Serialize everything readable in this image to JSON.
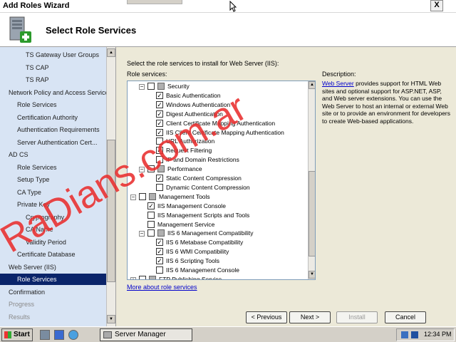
{
  "window": {
    "title": "Add Roles Wizard",
    "close_label": "X"
  },
  "header": {
    "heading": "Select Role Services"
  },
  "sidebar": {
    "items": [
      {
        "label": "TS Gateway User Groups",
        "state": "normal"
      },
      {
        "label": "TS CAP",
        "state": "normal"
      },
      {
        "label": "TS RAP",
        "state": "normal"
      },
      {
        "label": "Network Policy and Access Services",
        "state": "normal"
      },
      {
        "label": "Role Services",
        "state": "normal"
      },
      {
        "label": "Certification Authority",
        "state": "normal"
      },
      {
        "label": "Authentication Requirements",
        "state": "normal"
      },
      {
        "label": "Server Authentication Cert...",
        "state": "normal"
      },
      {
        "label": "AD CS",
        "state": "normal"
      },
      {
        "label": "Role Services",
        "state": "normal"
      },
      {
        "label": "Setup Type",
        "state": "normal"
      },
      {
        "label": "CA Type",
        "state": "normal"
      },
      {
        "label": "Private Key",
        "state": "normal"
      },
      {
        "label": "Cryptography",
        "state": "normal"
      },
      {
        "label": "CA Name",
        "state": "normal"
      },
      {
        "label": "Validity Period",
        "state": "normal"
      },
      {
        "label": "Certificate Database",
        "state": "normal"
      },
      {
        "label": "Web Server (IIS)",
        "state": "normal"
      },
      {
        "label": "Role Services",
        "state": "selected"
      },
      {
        "label": "Confirmation",
        "state": "normal"
      },
      {
        "label": "Progress",
        "state": "dim"
      },
      {
        "label": "Results",
        "state": "dim"
      }
    ]
  },
  "main": {
    "instruction": "Select the role services to install for Web Server (IIS):",
    "role_services_label": "Role services:",
    "description_label": "Description:",
    "description_link": "Web Server",
    "description_text": " provides support for HTML Web sites and optional support for ASP.NET, ASP, and Web server extensions. You can use the Web Server to host an internal or external Web site or to provide an environment for developers to create Web-based applications.",
    "more_link": "More about role services",
    "tree": [
      {
        "label": "Security",
        "checked": false,
        "expander": "−",
        "folder": true,
        "level": 1
      },
      {
        "label": "Basic Authentication",
        "checked": true,
        "level": 2
      },
      {
        "label": "Windows Authentication",
        "checked": true,
        "level": 2
      },
      {
        "label": "Digest Authentication",
        "checked": true,
        "level": 2
      },
      {
        "label": "Client Certificate Mapping Authentication",
        "checked": true,
        "level": 2
      },
      {
        "label": "IIS Client Certificate Mapping Authentication",
        "checked": true,
        "level": 2
      },
      {
        "label": "URL Authorization",
        "checked": false,
        "level": 2
      },
      {
        "label": "Request Filtering",
        "checked": true,
        "level": 2
      },
      {
        "label": "IP and Domain Restrictions",
        "checked": false,
        "level": 2
      },
      {
        "label": "Performance",
        "checked": false,
        "expander": "−",
        "folder": true,
        "level": 1
      },
      {
        "label": "Static Content Compression",
        "checked": true,
        "level": 2
      },
      {
        "label": "Dynamic Content Compression",
        "checked": false,
        "level": 2
      },
      {
        "label": "Management Tools",
        "checked": false,
        "expander": "−",
        "folder": true,
        "level": 0
      },
      {
        "label": "IIS Management Console",
        "checked": true,
        "level": 1
      },
      {
        "label": "IIS Management Scripts and Tools",
        "checked": false,
        "level": 1
      },
      {
        "label": "Management Service",
        "checked": false,
        "level": 1
      },
      {
        "label": "IIS 6 Management Compatibility",
        "checked": false,
        "expander": "−",
        "folder": true,
        "level": 1
      },
      {
        "label": "IIS 6 Metabase Compatibility",
        "checked": true,
        "level": 2
      },
      {
        "label": "IIS 6 WMI Compatibility",
        "checked": true,
        "level": 2
      },
      {
        "label": "IIS 6 Scripting Tools",
        "checked": true,
        "level": 2
      },
      {
        "label": "IIS 6 Management Console",
        "checked": false,
        "level": 2
      },
      {
        "label": "FTP Publishing Service",
        "checked": false,
        "expander": "+",
        "folder": true,
        "level": 0
      }
    ]
  },
  "buttons": {
    "previous": "< Previous",
    "next": "Next >",
    "install": "Install",
    "cancel": "Cancel"
  },
  "taskbar": {
    "start_label": "Start",
    "task_label": "Server Manager",
    "clock": "12:34 PM"
  },
  "watermark": "RaDians.com.ar"
}
